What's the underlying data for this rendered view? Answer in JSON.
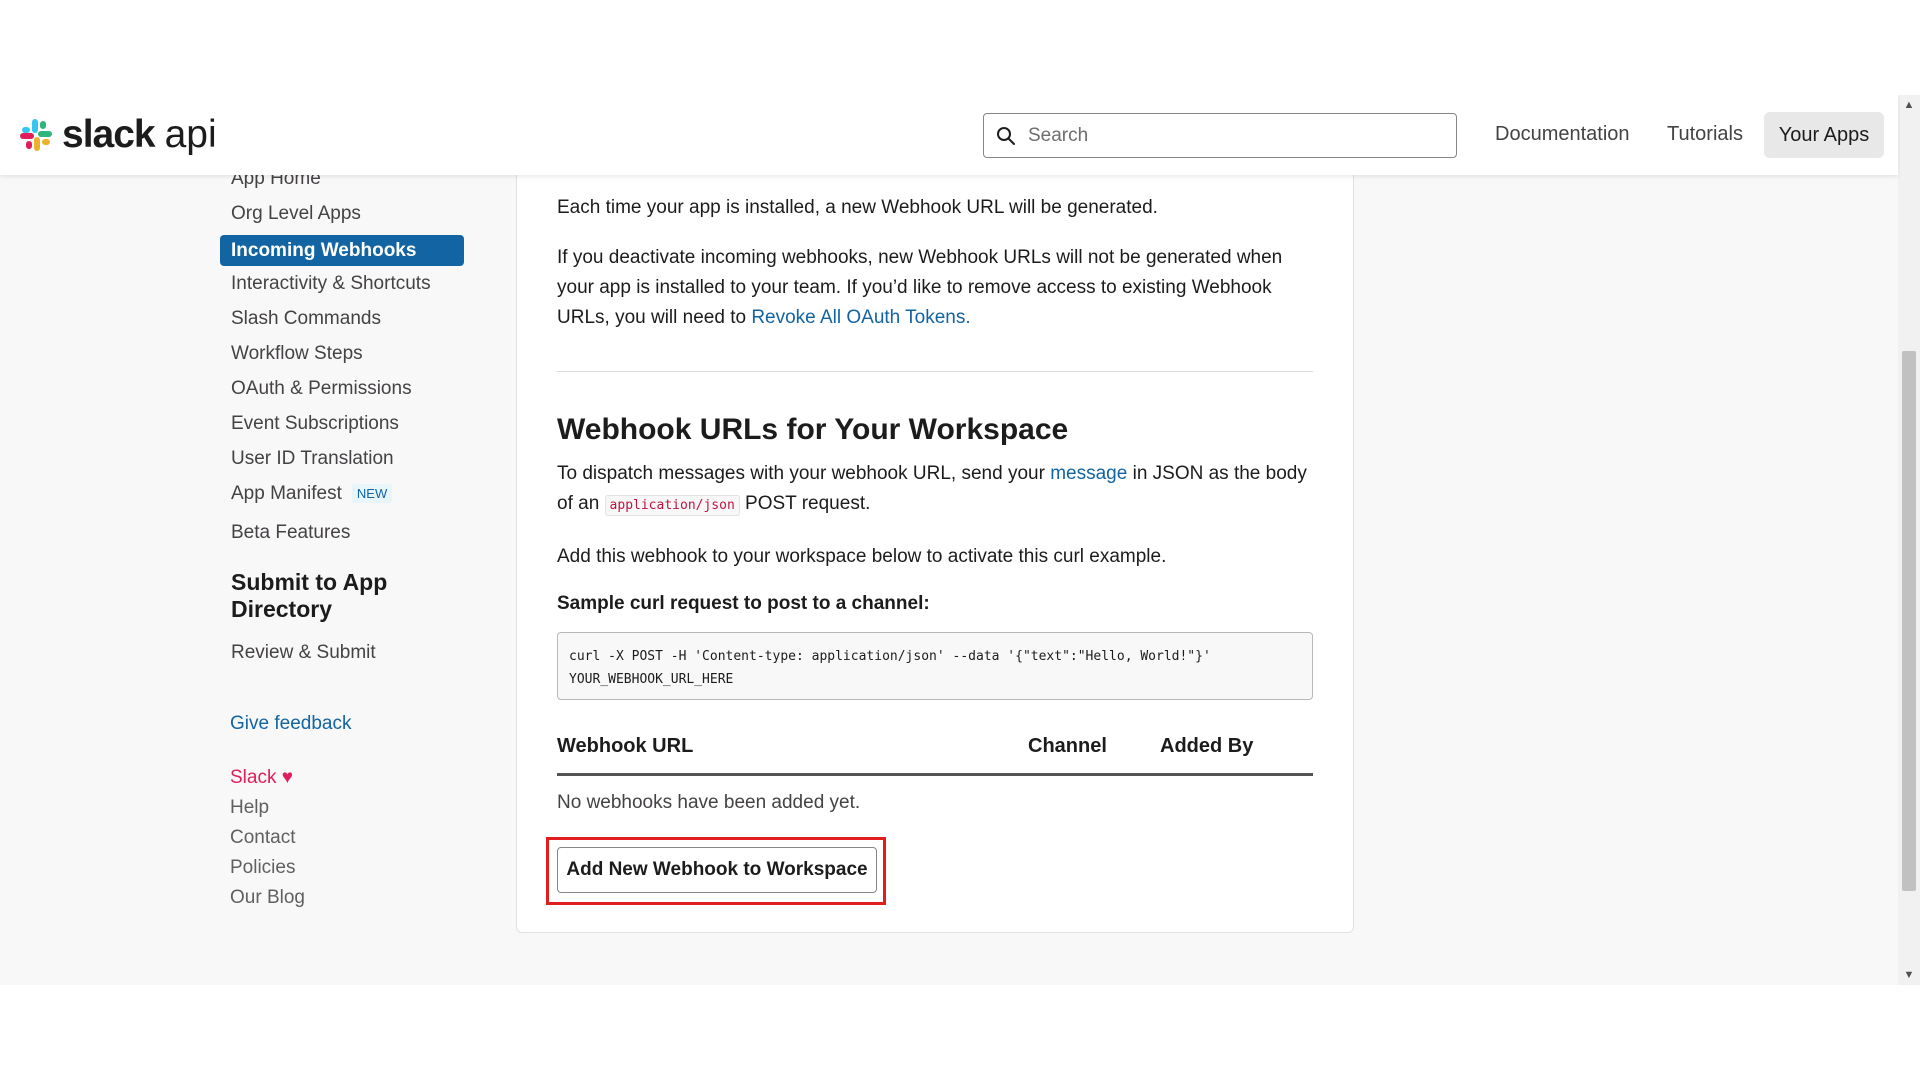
{
  "header": {
    "logo_text": "slack",
    "logo_suffix": "api",
    "search_placeholder": "Search",
    "nav": {
      "documentation": "Documentation",
      "tutorials": "Tutorials",
      "your_apps": "Your Apps"
    }
  },
  "sidebar": {
    "items": [
      "App Home",
      "Org Level Apps",
      "Incoming Webhooks",
      "Interactivity & Shortcuts",
      "Slash Commands",
      "Workflow Steps",
      "OAuth & Permissions",
      "Event Subscriptions",
      "User ID Translation",
      "App Manifest",
      "Beta Features"
    ],
    "new_badge": "NEW",
    "section_heading": "Submit to App Directory",
    "review_submit": "Review & Submit",
    "give_feedback": "Give feedback",
    "footer": {
      "slack": "Slack",
      "heart": "♥",
      "help": "Help",
      "contact": "Contact",
      "policies": "Policies",
      "blog": "Our Blog"
    }
  },
  "main": {
    "para1": "Each time your app is installed, a new Webhook URL will be generated.",
    "para2_text": "If you deactivate incoming webhooks, new Webhook URLs will not be generated when your app is installed to your team. If you’d like to remove access to existing Webhook URLs, you will need to ",
    "para2_link": "Revoke All OAuth Tokens",
    "para2_end": ".",
    "heading": "Webhook URLs for Your Workspace",
    "dispatch_text1": "To dispatch messages with your webhook URL, send your ",
    "dispatch_link": "message",
    "dispatch_text2": " in JSON as the body of an ",
    "dispatch_code": "application/json",
    "dispatch_text3": " POST request.",
    "add_text": "Add this webhook to your workspace below to activate this curl example.",
    "sample_label": "Sample curl request to post to a channel:",
    "curl_code": "curl -X POST -H 'Content-type: application/json' --data '{\"text\":\"Hello, World!\"}' YOUR_WEBHOOK_URL_HERE",
    "table": {
      "col_url": "Webhook URL",
      "col_channel": "Channel",
      "col_added_by": "Added By",
      "empty": "No webhooks have been added yet."
    },
    "add_button": "Add New Webhook to Workspace"
  },
  "colors": {
    "accent": "#1264a3",
    "highlight": "#e01e1e",
    "heart": "#e01e5a"
  }
}
